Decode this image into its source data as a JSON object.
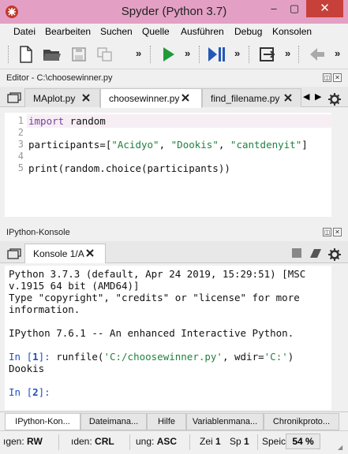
{
  "window": {
    "title": "Spyder (Python 3.7)",
    "minimize": "–",
    "maximize": "▢",
    "close": "✕"
  },
  "menu": [
    "Datei",
    "Bearbeiten",
    "Suchen",
    "Quelle",
    "Ausführen",
    "Debug",
    "Konsolen"
  ],
  "toolbar": {
    "more": "»"
  },
  "editor": {
    "pane_title": "Editor - C:\\choosewinner.py",
    "tabs": [
      "MAplot.py",
      "choosewinner.py",
      "find_filename.py"
    ],
    "active_tab": 1,
    "line_numbers": [
      "1",
      "2",
      "3",
      "4",
      "5"
    ],
    "code": {
      "l1_kw": "import",
      "l1_rest": " random",
      "l3_a": "participants=[",
      "l3_s1": "\"Acidyo\"",
      "l3_b": ", ",
      "l3_s2": "\"Dookis\"",
      "l3_c": ", ",
      "l3_s3": "\"cantdenyit\"",
      "l3_d": "]",
      "l5": "print(random.choice(participants))"
    }
  },
  "console": {
    "pane_title": "IPython-Konsole",
    "tab": "Konsole 1/A",
    "lines": [
      "Python 3.7.3 (default, Apr 24 2019, 15:29:51) [MSC",
      "v.1915 64 bit (AMD64)]",
      "Type \"copyright\", \"credits\" or \"license\" for more",
      "information.",
      "IPython 7.6.1 -- An enhanced Interactive Python."
    ],
    "in1_prompt": "In [",
    "in1_num": "1",
    "in1_end": "]: ",
    "in1_cmd_a": "runfile(",
    "in1_cmd_s1": "'C:/choosewinner.py'",
    "in1_cmd_b": ", wdir=",
    "in1_cmd_s2": "'C:'",
    "in1_cmd_c": ")",
    "output": "Dookis",
    "in2_prompt": "In [",
    "in2_num": "2",
    "in2_end": "]:"
  },
  "bottom_tabs": [
    "IPython-Kon...",
    "Dateimana...",
    "Hilfe",
    "Variablenmana...",
    "Chronikproto..."
  ],
  "status": {
    "perm_label": "ıgen:",
    "perm_value": "RW",
    "eol_label": "ıden:",
    "eol_value": "CRL",
    "enc_label": "ung:",
    "enc_value": "ASC",
    "line_label": "Zei",
    "line_value": "1",
    "col_label": "Sp",
    "col_value": "1",
    "mem_label": "Speic",
    "mem_value": "54 %"
  },
  "colors": {
    "titlebar": "#e3a0c4",
    "close": "#c7403a",
    "keyword": "#7a3ea1",
    "string": "#208040",
    "prompt": "#1f4fbf"
  }
}
